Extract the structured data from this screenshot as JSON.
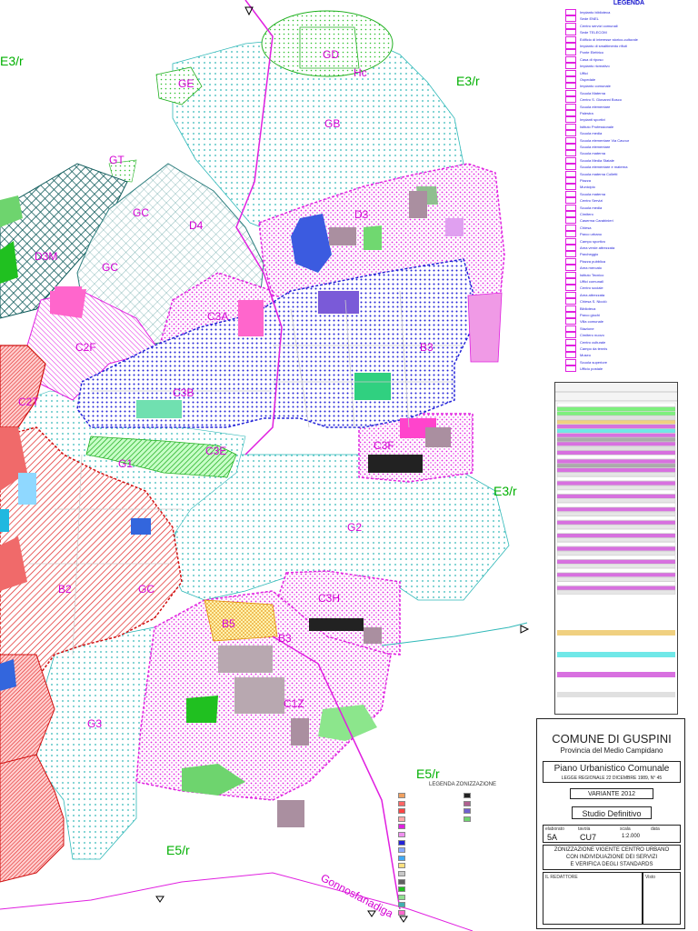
{
  "map_labels": {
    "e3r_top_left": "E3/r",
    "e3r_top_right": "E3/r",
    "e3r_right": "E3/r",
    "e5r_right": "E5/r",
    "e5r_bottom": "E5/r",
    "road_name": "Gonnosfanadiga"
  },
  "zone_labels": {
    "gd": "GD",
    "hc": "Hc",
    "ge": "GE",
    "gb": "GB",
    "gt": "GT",
    "gc1": "GC",
    "gc2": "GC",
    "d4": "D4",
    "d3": "D3",
    "c3b": "C3B",
    "c3a": "C3A",
    "b3": "B3",
    "c2f": "C2F",
    "c2t": "C2T",
    "g1": "G1",
    "c3e": "C3E",
    "c3f": "C3F",
    "g2": "G2",
    "c3h": "C3H",
    "b5": "B5",
    "b3b": "B3",
    "c1z": "C1Z",
    "b2": "B2",
    "gc3": "GC",
    "g3": "G3",
    "dm": "D3M"
  },
  "legend": {
    "title": "LEGENDA",
    "items": [
      "Impianto biblioteca",
      "Sede ENEL",
      "Centro servizi comunali",
      "Sede TELECOM",
      "Edificio di interesse storico-culturale",
      "Impianto di smaltimento rifiuti",
      "Ponte Elettrico",
      "Casa di riposo",
      "Impianto ricreativo",
      "Uffici",
      "Ospedale",
      "Impianto comunale",
      "Scuola Materna",
      "Centro S. Giovanni Bosco",
      "Scuola elementare",
      "Palestra",
      "Impianti sportivi",
      "Istituto Professionale",
      "Scuola media",
      "Scuola elementare Via Cavour",
      "Scuola elementare",
      "Scuola materna",
      "Scuola Media Statale",
      "Scuola elementare e materna",
      "Scuola materna Colletti",
      "Piazza",
      "Municipio",
      "Scuola materna",
      "Centro Servizi",
      "Scuola media",
      "Cimitero",
      "Caserma Carabinieri",
      "Chiesa",
      "Parco urbano",
      "Campo sportivo",
      "Area verde attrezzata",
      "Parcheggio",
      "Piazza pubblica",
      "Area mercato",
      "Istituto Tecnico",
      "Uffici comunali",
      "Centro sociale",
      "Area attrezzata",
      "Chiesa S. Nicolò",
      "Biblioteca",
      "Parco giochi",
      "Villa comunale",
      "Stazione",
      "Cimitero nuovo",
      "Centro culturale",
      "Campo da tennis",
      "Museo",
      "Scuola superiore",
      "Ufficio postale"
    ]
  },
  "cartiglio": {
    "comune": "COMUNE DI GUSPINI",
    "provincia": "Provincia del Medio Campidano",
    "piano": "Piano Urbanistico Comunale",
    "legge": "LEGGE REGIONALE 22 DICEMBRE 1989, N° 45",
    "variante": "VARIANTE 2012",
    "studio": "Studio Definitivo",
    "tav_label": "elaborato",
    "tav_value": "5A",
    "code_label": "tavola",
    "code_value": "CU7",
    "scale_label": "scala",
    "scale_value": "1:2.000",
    "data_label": "data",
    "subject_1": "ZONIZZAZIONE VIGENTE CENTRO URBANO",
    "subject_2": "CON INDIVIDUAZIONE DEI SERVIZI",
    "subject_3": "E VERIFICA DEGLI STANDARDS",
    "redattori": "IL REDATTORE",
    "visto": "Visto"
  },
  "zone_legend": {
    "title": "LEGENDA ZONIZZAZIONE"
  },
  "colors": {
    "magenta": "#e020e0",
    "green": "#00b000",
    "blue": "#2323d8",
    "red": "#e02020",
    "cyan": "#00b0b0"
  }
}
